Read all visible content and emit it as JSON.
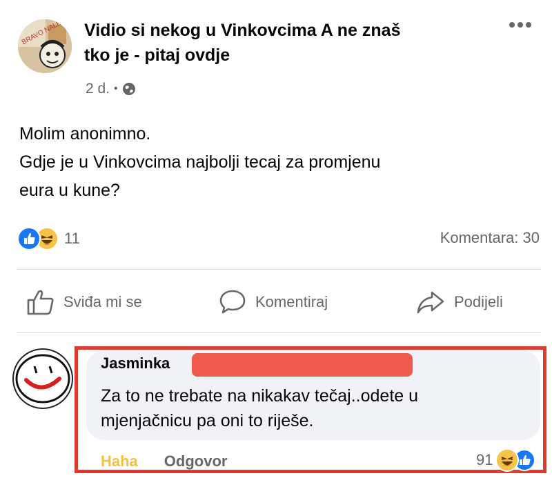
{
  "post": {
    "group_name_line1": "Vidio si nekog u Vinkovcima A ne znaš",
    "group_name_line2": "tko je - pitaj ovdje",
    "avatar_text": "BRAVO NALETI",
    "time": "2 d.",
    "separator": "•",
    "privacy_icon": "globe-icon",
    "more_icon": "more-dots-icon",
    "body_lines": [
      "Molim anonimno.",
      "Gdje je u Vinkovcima najbolji tecaj za promjenu",
      "eura u kune?"
    ],
    "reaction_count": "11",
    "comments_label": "Komentara: 30"
  },
  "actions": {
    "like": "Sviđa mi se",
    "comment": "Komentiraj",
    "share": "Podijeli"
  },
  "comment": {
    "author": "Jasminka",
    "text_lines": [
      "Za to ne trebate na nikakav tečaj..odete u",
      "mjenjačnicu pa oni to riješe."
    ],
    "haha_label": "Haha",
    "reply_label": "Odgovor",
    "reaction_count": "91"
  },
  "colors": {
    "highlight": "#e03b32",
    "redaction": "#f05a4d",
    "like_blue": "#1877f2",
    "haha_yellow": "#f7c447"
  }
}
